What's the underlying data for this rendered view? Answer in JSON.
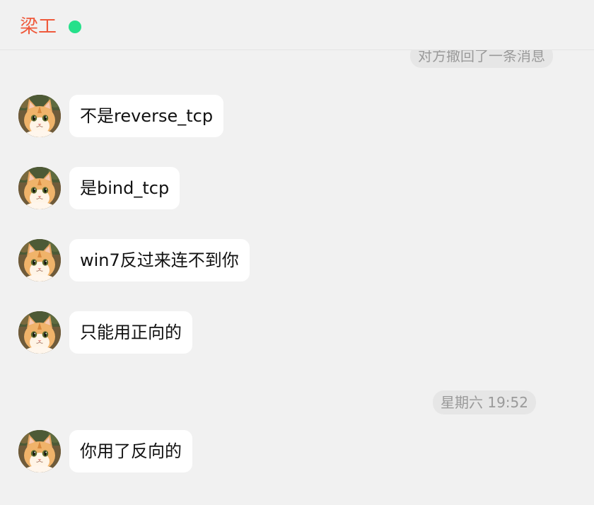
{
  "header": {
    "contact_name": "梁工",
    "online_color": "#25e08a"
  },
  "system": {
    "recall_notice": "对方撤回了一条消息",
    "time_divider": "星期六 19:52"
  },
  "messages": [
    {
      "sender": "contact",
      "avatar_icon": "cat-avatar-icon",
      "text": "不是reverse_tcp"
    },
    {
      "sender": "contact",
      "avatar_icon": "cat-avatar-icon",
      "text": "是bind_tcp"
    },
    {
      "sender": "contact",
      "avatar_icon": "cat-avatar-icon",
      "text": "win7反过来连不到你"
    },
    {
      "sender": "contact",
      "avatar_icon": "cat-avatar-icon",
      "text": "只能用正向的"
    },
    {
      "sender": "contact",
      "avatar_icon": "cat-avatar-icon",
      "text": "你用了反向的"
    }
  ]
}
